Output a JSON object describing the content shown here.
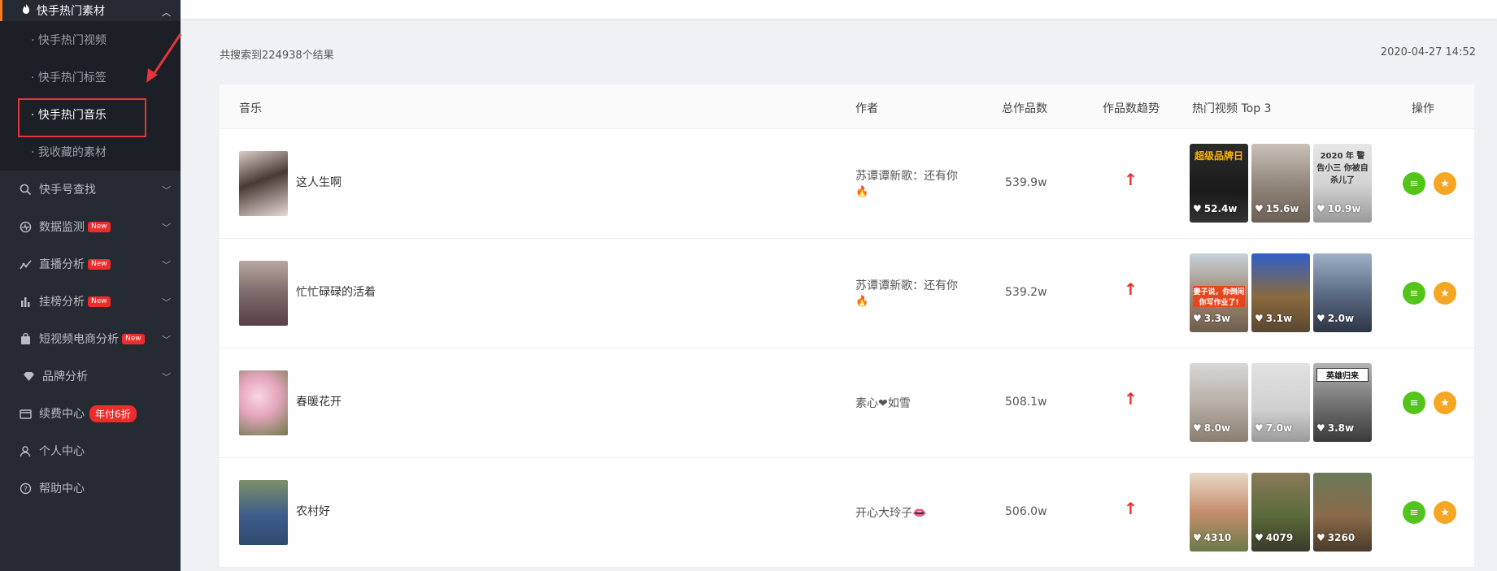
{
  "sidebar": {
    "section": {
      "label": "快手热门素材"
    },
    "subitems": [
      {
        "label": "· 快手热门视频"
      },
      {
        "label": "· 快手热门标签"
      },
      {
        "label": "· 快手热门音乐"
      },
      {
        "label": "· 我收藏的素材"
      }
    ],
    "items": [
      {
        "label": "快手号查找",
        "icon": "search-icon"
      },
      {
        "label": "数据监测",
        "icon": "monitor-icon",
        "badge": "New"
      },
      {
        "label": "直播分析",
        "icon": "line-chart-icon",
        "badge": "New"
      },
      {
        "label": "挂榜分析",
        "icon": "bar-chart-icon",
        "badge": "New"
      },
      {
        "label": "短视频电商分析",
        "icon": "bag-icon",
        "badge": "New"
      },
      {
        "label": "品牌分析",
        "icon": "diamond-icon"
      },
      {
        "label": "续费中心",
        "icon": "card-icon",
        "badge": "年付6折"
      },
      {
        "label": "个人中心",
        "icon": "user-icon"
      },
      {
        "label": "帮助中心",
        "icon": "help-icon"
      }
    ]
  },
  "summary": "共搜索到224938个结果",
  "timestamp": "2020-04-27 14:52",
  "table": {
    "headers": {
      "music": "音乐",
      "author": "作者",
      "total": "总作品数",
      "trend": "作品数趋势",
      "top3": "热门视频 Top 3",
      "ops": "操作"
    },
    "rows": [
      {
        "title": "这人生啊",
        "author": "苏谭谭新歌：还有你",
        "author_emoji": "🔥",
        "count": "539.9w",
        "trend": "↑",
        "videos": [
          {
            "likes": "52.4w",
            "tag": "超级品牌日"
          },
          {
            "likes": "15.6w",
            "tag": ""
          },
          {
            "likes": "10.9w",
            "tag": "2020 年 警告小三 你被自杀儿了"
          }
        ]
      },
      {
        "title": "忙忙碌碌的活着",
        "author": "苏谭谭新歌：还有你",
        "author_emoji": "🔥",
        "count": "539.2w",
        "trend": "↑",
        "videos": [
          {
            "likes": "3.3w",
            "tag": "妻子说，你倒闲 你写作业了!"
          },
          {
            "likes": "3.1w",
            "tag": ""
          },
          {
            "likes": "2.0w",
            "tag": ""
          }
        ]
      },
      {
        "title": "春暖花开",
        "author": "素心❤如雪",
        "author_emoji": "",
        "count": "508.1w",
        "trend": "↑",
        "videos": [
          {
            "likes": "8.0w",
            "tag": ""
          },
          {
            "likes": "7.0w",
            "tag": ""
          },
          {
            "likes": "3.8w",
            "tag": "英雄归来"
          }
        ]
      },
      {
        "title": "农村好",
        "author": "开心大玲子",
        "author_emoji": "👄",
        "count": "506.0w",
        "trend": "↑",
        "videos": [
          {
            "likes": "4310",
            "tag": ""
          },
          {
            "likes": "4079",
            "tag": ""
          },
          {
            "likes": "3260",
            "tag": ""
          }
        ]
      }
    ]
  },
  "colors": {
    "accent": "#ff7a1a",
    "sidebar": "#262a33",
    "trend": "#f02b2b",
    "detail": "#52c41a",
    "favorite": "#f5a623"
  }
}
